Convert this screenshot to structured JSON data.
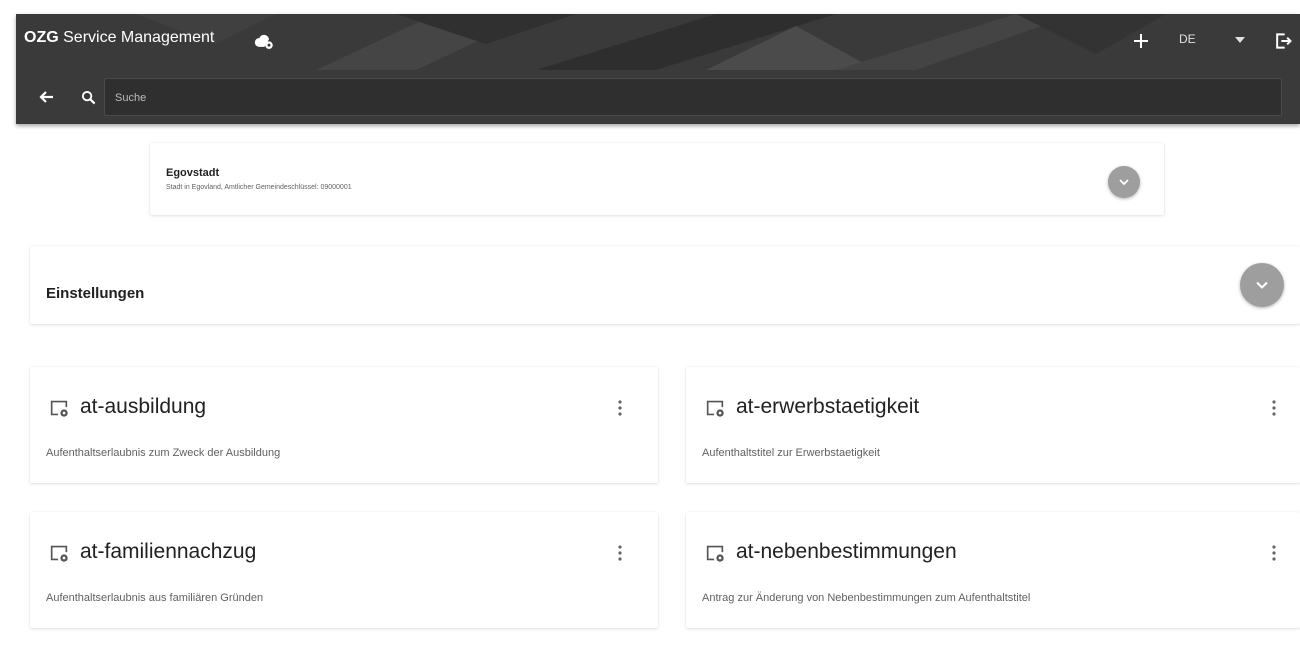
{
  "header": {
    "brand_bold": "OZG",
    "brand_rest": " Service Management",
    "language": "DE",
    "icons": {
      "brand": "cloud-settings-icon",
      "add": "plus-icon",
      "language_menu": "caret-down-icon",
      "logout": "logout-icon"
    }
  },
  "search": {
    "placeholder": "Suche",
    "value": "",
    "icons": {
      "back": "arrow-left-icon",
      "search": "search-icon"
    }
  },
  "tenant": {
    "name": "Egovstadt",
    "description": "Stadt in Egovland, Amtlicher Gemeindeschlüssel: 09000001",
    "toggle_icon": "chevron-down-icon"
  },
  "settings": {
    "title": "Einstellungen",
    "toggle_icon": "chevron-down-icon"
  },
  "services": [
    {
      "title": "at-ausbildung",
      "description": "Aufenthaltserlaubnis zum Zweck der Ausbildung",
      "icon": "service-settings-icon",
      "menu_icon": "more-vert-icon"
    },
    {
      "title": "at-erwerbstaetigkeit",
      "description": "Aufenthaltstitel zur Erwerbstaetigkeit",
      "icon": "service-settings-icon",
      "menu_icon": "more-vert-icon"
    },
    {
      "title": "at-familiennachzug",
      "description": "Aufenthaltserlaubnis aus familiären Gründen",
      "icon": "service-settings-icon",
      "menu_icon": "more-vert-icon"
    },
    {
      "title": "at-nebenbestimmungen",
      "description": "Antrag zur Änderung von Nebenbestimmungen zum Aufenthaltstitel",
      "icon": "service-settings-icon",
      "menu_icon": "more-vert-icon"
    }
  ],
  "colors": {
    "appbar": "#3a3a3a",
    "round_button": "#9e9e9e",
    "text_primary": "#212121",
    "text_secondary": "#616161"
  }
}
